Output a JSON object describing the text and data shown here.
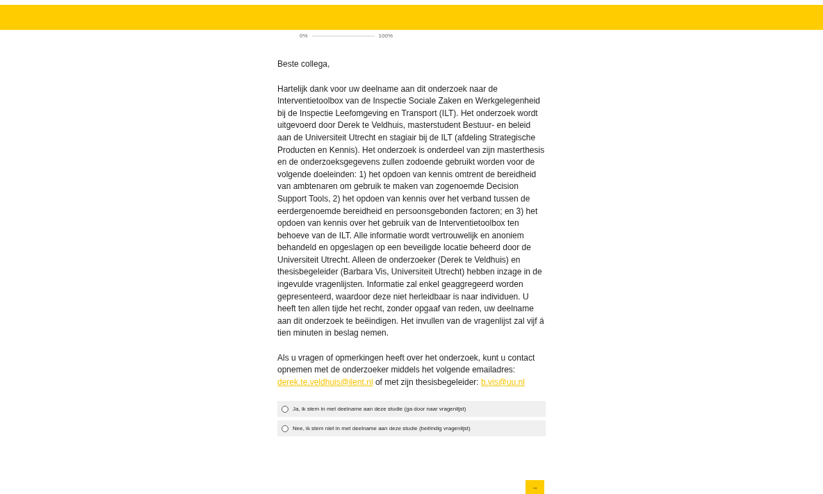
{
  "progress": {
    "start_label": "0%",
    "end_label": "100%",
    "level": 0
  },
  "greeting": "Beste collega,",
  "intro": "Hartelijk dank voor uw deelname aan dit onderzoek naar de Interventietoolbox van de Inspectie Sociale Zaken en Werkgelegenheid bij de Inspectie Leefomgeving en Transport (ILT). Het onderzoek wordt uitgevoerd door Derek te Veldhuis, masterstudent Bestuur- en beleid aan de Universiteit Utrecht en stagiair bij de ILT (afdeling Strategische Producten en Kennis). Het onderzoek is onderdeel van zijn masterthesis en de onderzoeksgegevens zullen zodoende gebruikt worden voor de volgende doeleinden: 1) het opdoen van kennis omtrent de bereidheid van ambtenaren om gebruik te maken van zogenoemde Decision Support Tools, 2) het opdoen van kennis over het verband tussen de eerdergenoemde bereidheid en persoonsgebonden factoren; en 3) het opdoen van kennis over het gebruik van de Interventietoolbox ten behoeve van de ILT. Alle informatie wordt vertrouwelijk en anoniem behandeld en opgeslagen op een beveiligde locatie beheerd door de Universiteit Utrecht. Alleen de onderzoeker (Derek te Veldhuis) en thesisbegeleider (Barbara Vis, Universiteit Utrecht) hebben inzage in de ingevulde vragenlijsten. Informatie zal enkel geaggregeerd worden gepresenteerd, waardoor deze niet herleidbaar is naar individuen. U heeft ten allen tijde het recht, zonder opgaaf van reden, uw deelname aan dit onderzoek te beëindigen. Het invullen van de vragenlijst zal vijf á tien minuten in beslag nemen.",
  "contact": {
    "text_before": "Als u vragen of opmerkingen heeft over het onderzoek, kunt u contact opnemen met de onderzoeker middels het volgende emailadres:",
    "email_1": "derek.te.veldhuis@ilent.nl",
    "text_middle": "of met zijn thesisbegeleider:",
    "email_2": "b.vis@uu.nl"
  },
  "options": [
    {
      "label": "Ja, ik stem in met deelname aan deze studie (ga door naar vragenlijst)",
      "selected": false
    },
    {
      "label": "Nee, ik stem niet in met deelname aan deze studie (beëindig vragenlijst)",
      "selected": false
    }
  ],
  "next_button": {
    "label": "→"
  }
}
